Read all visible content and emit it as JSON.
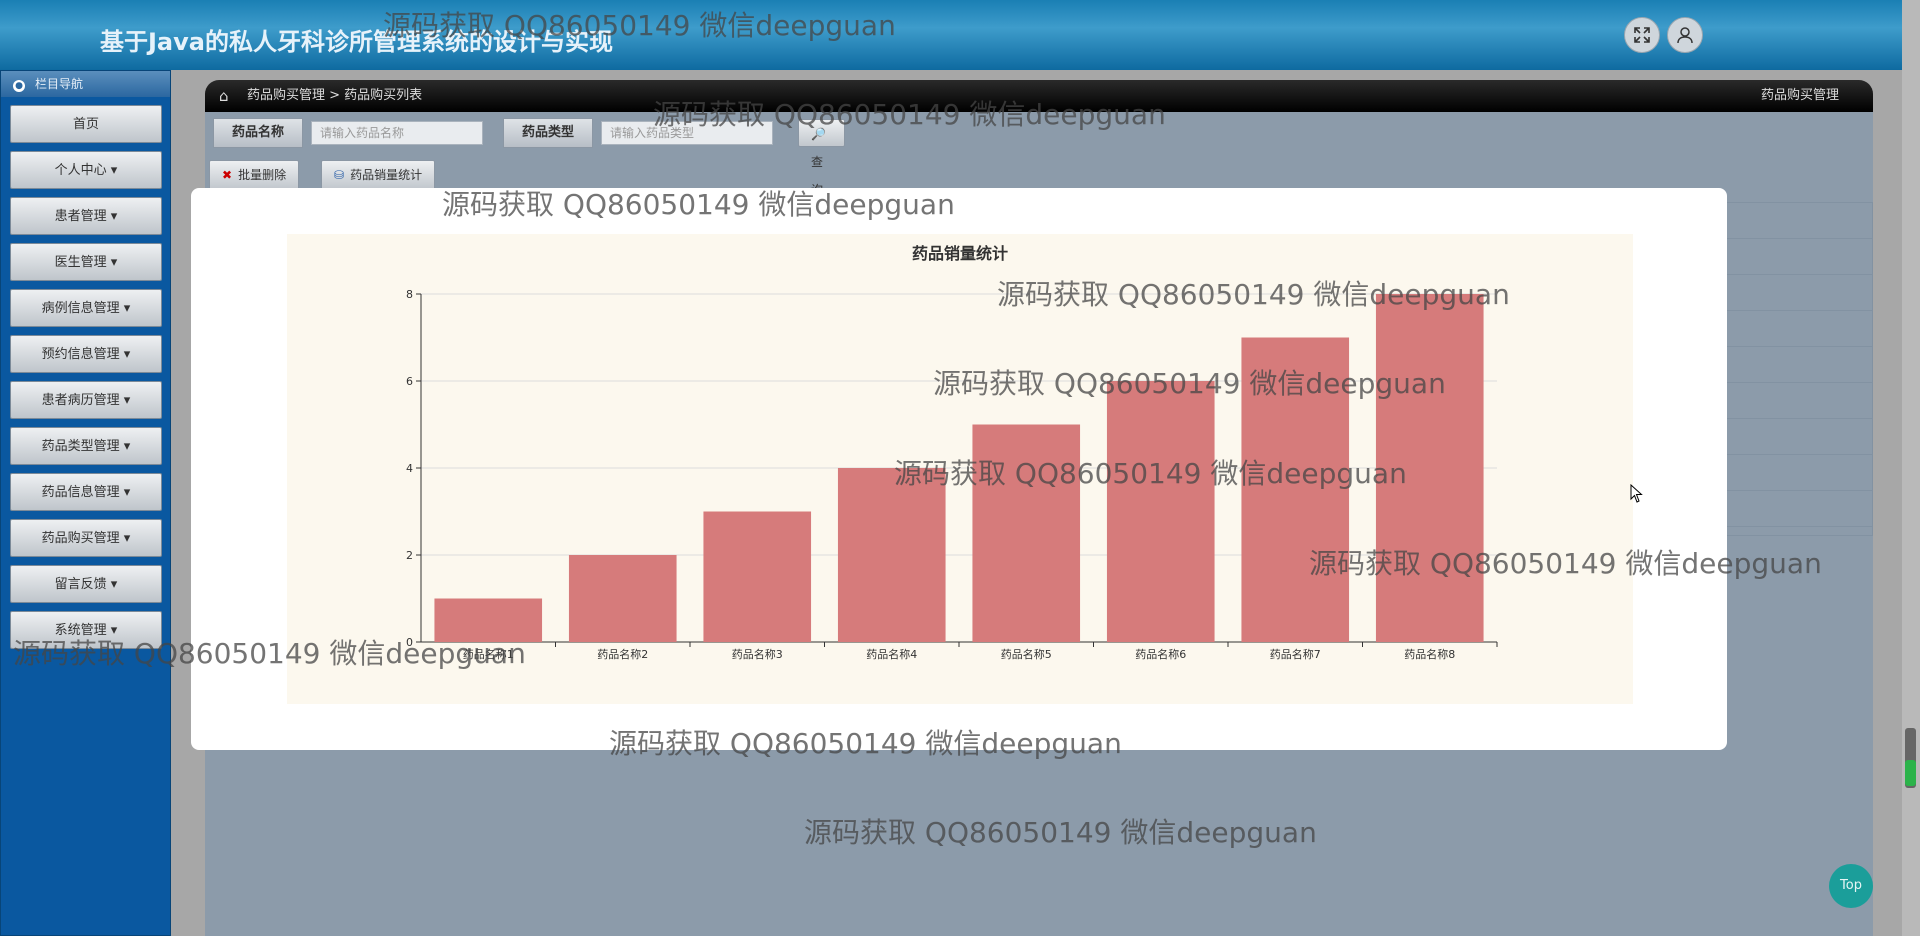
{
  "app": {
    "title": "基于Java的私人牙科诊所管理系统的设计与实现"
  },
  "header": {
    "fullscreen_icon": "expand-icon",
    "user_icon": "user-icon"
  },
  "sidebar": {
    "title": "栏目导航",
    "items": [
      {
        "label": "首页"
      },
      {
        "label": "个人中心 ▾"
      },
      {
        "label": "患者管理 ▾"
      },
      {
        "label": "医生管理 ▾"
      },
      {
        "label": "病例信息管理 ▾"
      },
      {
        "label": "预约信息管理 ▾"
      },
      {
        "label": "患者病历管理 ▾"
      },
      {
        "label": "药品类型管理 ▾"
      },
      {
        "label": "药品信息管理 ▾"
      },
      {
        "label": "药品购买管理 ▾"
      },
      {
        "label": "留言反馈 ▾"
      },
      {
        "label": "系统管理 ▾"
      }
    ]
  },
  "breadcrumb": {
    "path": "药品购买管理 > 药品购买列表",
    "right": "药品购买管理"
  },
  "search": {
    "name_label": "药品名称",
    "name_placeholder": "请输入药品名称",
    "type_label": "药品类型",
    "type_placeholder": "请输入药品类型",
    "query_button": "查询"
  },
  "toolbar": {
    "batch_delete": "批量删除",
    "stats": "药品销量统计"
  },
  "chart_data": {
    "type": "bar",
    "title": "药品销量统计",
    "categories": [
      "药品名称1",
      "药品名称2",
      "药品名称3",
      "药品名称4",
      "药品名称5",
      "药品名称6",
      "药品名称7",
      "药品名称8"
    ],
    "values": [
      1,
      2,
      3,
      4,
      5,
      6,
      7,
      8
    ],
    "ylim": [
      0,
      8
    ],
    "yticks": [
      0,
      2,
      4,
      6,
      8
    ],
    "bar_color": "#d67b7b",
    "grid": true,
    "xlabel": "",
    "ylabel": ""
  },
  "watermark": "源码获取 QQ86050149 微信deepguan",
  "top_button": "Top"
}
